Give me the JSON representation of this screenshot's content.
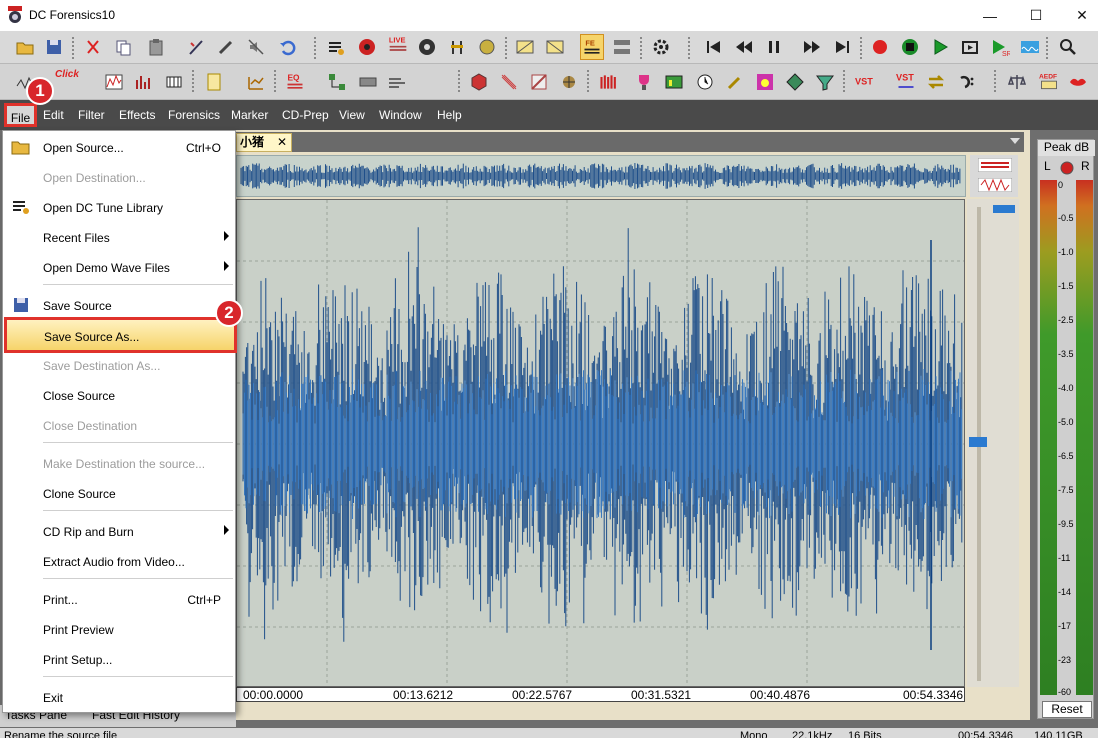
{
  "window": {
    "title": "DC Forensics10",
    "minimize_glyph": "—",
    "maximize_glyph": "☐",
    "close_glyph": "✕"
  },
  "toolbar2": {
    "click_label": "Click",
    "eq_label": "EQ",
    "vst1_label": "VST",
    "vst2_label": "VST",
    "live_label": "LIVE",
    "fe_label": "FE",
    "aedf_label": "AEDF"
  },
  "menubar": {
    "items": [
      "File",
      "Edit",
      "Filter",
      "Effects",
      "Forensics",
      "Marker",
      "CD-Prep",
      "View",
      "Window",
      "Help"
    ]
  },
  "file_menu": {
    "items": [
      {
        "label": "Open Source...",
        "shortcut": "Ctrl+O",
        "enabled": true
      },
      {
        "label": "Open Destination...",
        "enabled": false
      },
      {
        "label": "Open DC Tune Library",
        "enabled": true
      },
      {
        "label": "Recent Files",
        "submenu": true,
        "enabled": true
      },
      {
        "label": "Open Demo Wave Files",
        "submenu": true,
        "enabled": true
      },
      {
        "label": "Save Source",
        "enabled": true
      },
      {
        "label": "Save Source As...",
        "enabled": true,
        "highlighted": true
      },
      {
        "label": "Save Destination As...",
        "enabled": false
      },
      {
        "label": "Close Source",
        "enabled": true
      },
      {
        "label": "Close Destination",
        "enabled": false
      },
      {
        "label": "Make Destination the source...",
        "enabled": false
      },
      {
        "label": "Clone Source",
        "enabled": true
      },
      {
        "label": "CD Rip and Burn",
        "submenu": true,
        "enabled": true
      },
      {
        "label": "Extract Audio from Video...",
        "enabled": true
      },
      {
        "label": "Print...",
        "shortcut": "Ctrl+P",
        "enabled": true
      },
      {
        "label": "Print Preview",
        "enabled": true
      },
      {
        "label": "Print Setup...",
        "enabled": true
      },
      {
        "label": "Exit",
        "enabled": true
      }
    ]
  },
  "document": {
    "tab_title": "小猪",
    "tab_close": "✕",
    "timeline": [
      "00:00.0000",
      "00:13.6212",
      "00:22.5767",
      "00:31.5321",
      "00:40.4876",
      "00:54.3346"
    ]
  },
  "meter": {
    "title": "Peak dB",
    "left": "L",
    "right": "R",
    "ticks": [
      "0",
      "-0.5",
      "-1.0",
      "-1.5",
      "-2.5",
      "-3.5",
      "-4.0",
      "-5.0",
      "-6.5",
      "-7.5",
      "-9.5",
      "-11",
      "-14",
      "-17",
      "-23",
      "-60"
    ],
    "reset_label": "Reset"
  },
  "bottom_tabs": {
    "tasks": "Tasks Pane",
    "history": "Fast Edit History"
  },
  "status": {
    "hint": "Rename the source file",
    "channels": "Mono",
    "rate": "22.1kHz",
    "bits": "16 Bits",
    "length": "00:54.3346",
    "disk": "140.11GB"
  },
  "callouts": {
    "one": "1",
    "two": "2"
  },
  "colors": {
    "accent_red": "#e0322b",
    "waveform_blue": "#1f4f8a",
    "menubar": "#4a4a4a",
    "highlight": "#f6d46a"
  }
}
